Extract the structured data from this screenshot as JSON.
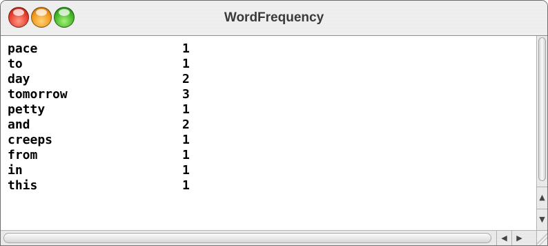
{
  "window": {
    "title": "WordFrequency"
  },
  "table": {
    "rows": [
      {
        "word": "pace",
        "count": "1"
      },
      {
        "word": "to",
        "count": "1"
      },
      {
        "word": "day",
        "count": "2"
      },
      {
        "word": "tomorrow",
        "count": "3"
      },
      {
        "word": "petty",
        "count": "1"
      },
      {
        "word": "and",
        "count": "2"
      },
      {
        "word": "creeps",
        "count": "1"
      },
      {
        "word": "from",
        "count": "1"
      },
      {
        "word": "in",
        "count": "1"
      },
      {
        "word": "this",
        "count": "1"
      }
    ]
  },
  "icons": {
    "close": "close-button-icon",
    "minimize": "minimize-button-icon",
    "zoom": "zoom-button-icon",
    "scroll_up": "up-arrow-icon",
    "scroll_down": "down-arrow-icon",
    "scroll_left": "left-arrow-icon",
    "scroll_right": "right-arrow-icon"
  },
  "colors": {
    "close": "#e8412f",
    "minimize": "#f29a1c",
    "zoom": "#44b82a"
  }
}
